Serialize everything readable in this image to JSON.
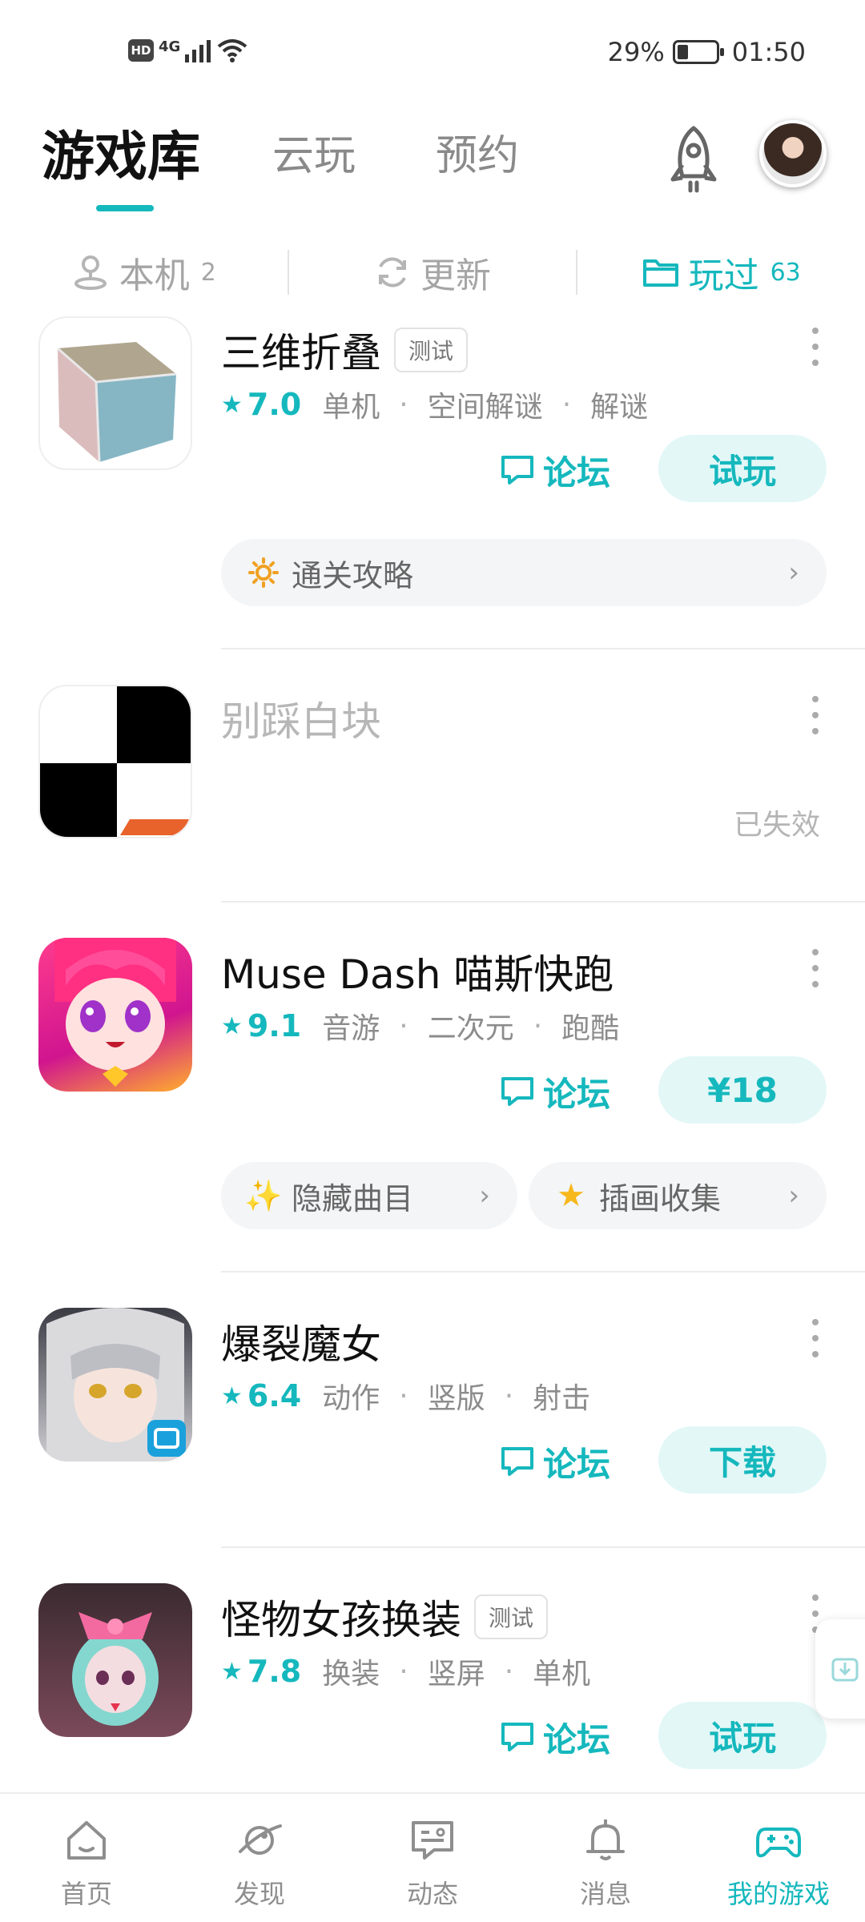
{
  "status_bar": {
    "hd": "HD",
    "network": "4G",
    "battery_percent": "29%",
    "battery_level": 0.29,
    "time": "01:50"
  },
  "header": {
    "tabs": [
      {
        "label": "游戏库",
        "active": true
      },
      {
        "label": "云玩",
        "active": false
      },
      {
        "label": "预约",
        "active": false
      }
    ],
    "accent": "#15b8bd"
  },
  "filters": [
    {
      "label": "本机",
      "count": "2",
      "icon": "user-device-icon",
      "active": false
    },
    {
      "label": "更新",
      "count": "",
      "icon": "refresh-icon",
      "active": false
    },
    {
      "label": "玩过",
      "count": "63",
      "icon": "folder-icon",
      "active": true
    }
  ],
  "games": [
    {
      "title": "三维折叠",
      "badge": "测试",
      "rating": "7.0",
      "tags": [
        "单机",
        "空间解谜",
        "解谜"
      ],
      "forum_label": "论坛",
      "action_label": "试玩",
      "guides": [
        {
          "label": "通关攻略",
          "icon": "sun-icon"
        }
      ]
    },
    {
      "title": "别踩白块",
      "status": "已失效"
    },
    {
      "title": "Muse Dash 喵斯快跑",
      "rating": "9.1",
      "tags": [
        "音游",
        "二次元",
        "跑酷"
      ],
      "forum_label": "论坛",
      "action_label": "¥18",
      "guides": [
        {
          "label": "隐藏曲目",
          "icon": "sparkle-icon"
        },
        {
          "label": "插画收集",
          "icon": "star-icon"
        }
      ]
    },
    {
      "title": "爆裂魔女",
      "rating": "6.4",
      "tags": [
        "动作",
        "竖版",
        "射击"
      ],
      "forum_label": "论坛",
      "action_label": "下载"
    },
    {
      "title": "怪物女孩换装",
      "badge": "测试",
      "rating": "7.8",
      "tags": [
        "换装",
        "竖屏",
        "单机"
      ],
      "forum_label": "论坛",
      "action_label": "试玩"
    }
  ],
  "bottom_nav": [
    {
      "label": "首页",
      "icon": "home-icon",
      "active": false
    },
    {
      "label": "发现",
      "icon": "planet-icon",
      "active": false
    },
    {
      "label": "动态",
      "icon": "chat-icon",
      "active": false
    },
    {
      "label": "消息",
      "icon": "bell-icon",
      "active": false
    },
    {
      "label": "我的游戏",
      "icon": "gamepad-icon",
      "active": true
    }
  ]
}
